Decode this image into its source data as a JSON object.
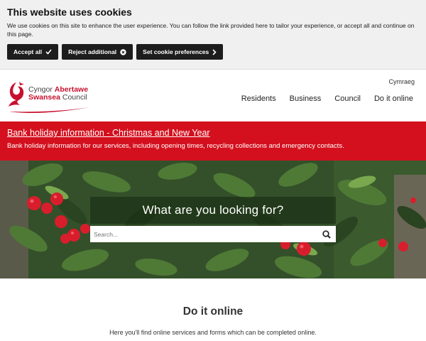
{
  "cookie": {
    "title": "This website uses cookies",
    "text": "We use cookies on this site to enhance the user experience. You can follow the link provided here to tailor your experience, or accept all and continue on this page.",
    "accept_label": "Accept all",
    "reject_label": "Reject additional",
    "prefs_label": "Set cookie preferences"
  },
  "header": {
    "logo_line1_a": "Cyngor",
    "logo_line1_b": "Abertawe",
    "logo_line2_a": "Swansea",
    "logo_line2_b": "Council",
    "language_link": "Cymraeg",
    "nav": [
      "Residents",
      "Business",
      "Council",
      "Do it online"
    ]
  },
  "alert": {
    "title": "Bank holiday information - Christmas and New Year",
    "subtitle": "Bank holiday information for our services, including opening times, recycling collections and emergency contacts."
  },
  "search": {
    "heading": "What are you looking for?",
    "placeholder": "Search..."
  },
  "online": {
    "heading": "Do it online",
    "text": "Here you'll find online services and forms which can be completed online."
  },
  "colors": {
    "brand_red": "#d4101e",
    "button_dark": "#1d1d1d",
    "banner_bg": "#f0f0f0"
  },
  "icons": [
    "check-icon",
    "close-circle-icon",
    "chevron-right-icon",
    "dragon-logo-icon",
    "search-icon"
  ]
}
